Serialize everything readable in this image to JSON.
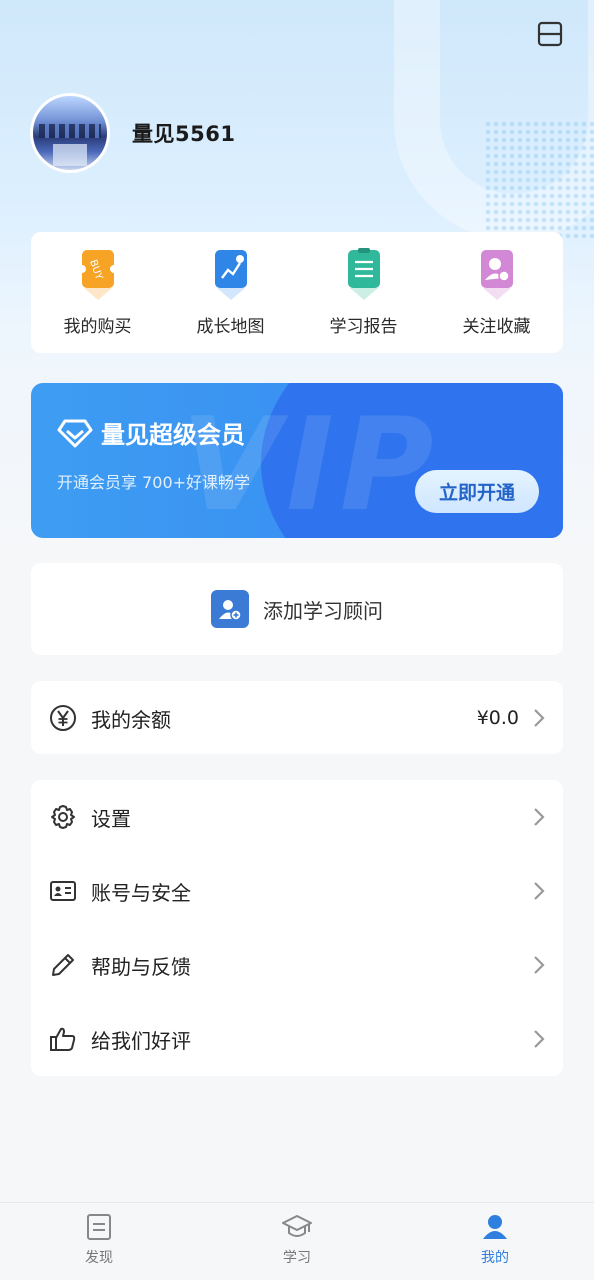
{
  "profile": {
    "username": "量见5561"
  },
  "quick_actions": [
    {
      "label": "我的购买",
      "icon": "buy-ticket-icon",
      "color": "#f7a325"
    },
    {
      "label": "成长地图",
      "icon": "growth-map-icon",
      "color": "#2f86e6"
    },
    {
      "label": "学习报告",
      "icon": "report-clipboard-icon",
      "color": "#2fb89a"
    },
    {
      "label": "关注收藏",
      "icon": "favorite-user-icon",
      "color": "#d388d6"
    }
  ],
  "vip": {
    "title": "量见超级会员",
    "subtitle": "开通会员享 700+好课畅学",
    "button_label": "立即开通",
    "watermark": "VIP"
  },
  "advisor": {
    "label": "添加学习顾问"
  },
  "balance": {
    "label": "我的余额",
    "value": "¥0.0"
  },
  "menu": [
    {
      "label": "设置",
      "icon": "gear-icon"
    },
    {
      "label": "账号与安全",
      "icon": "id-card-icon"
    },
    {
      "label": "帮助与反馈",
      "icon": "pencil-icon"
    },
    {
      "label": "给我们好评",
      "icon": "thumbs-up-icon"
    }
  ],
  "tabbar": {
    "tabs": [
      {
        "label": "发现",
        "icon": "document-icon",
        "active": false
      },
      {
        "label": "学习",
        "icon": "graduation-cap-icon",
        "active": false
      },
      {
        "label": "我的",
        "icon": "user-icon",
        "active": true
      }
    ],
    "active_color": "#2f7fe0"
  }
}
